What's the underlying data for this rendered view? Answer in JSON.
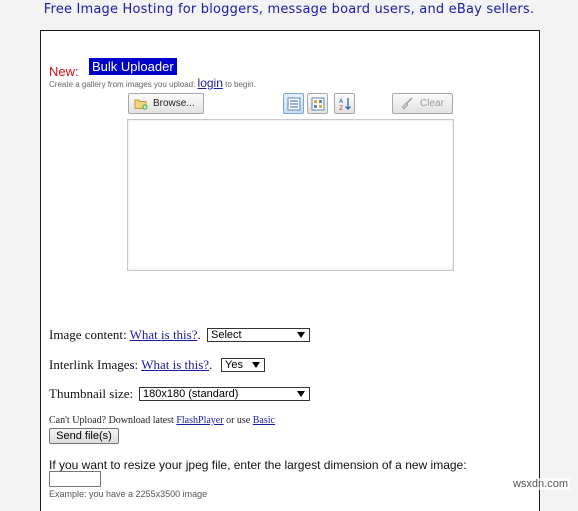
{
  "header": {
    "tagline": "Free Image Hosting for bloggers, message board users, and eBay sellers."
  },
  "uploader": {
    "new_label": "New:",
    "bulk_uploader_label": "Bulk Uploader",
    "gallery_prefix": "Create a gallery from images you upload:",
    "login_link": "login",
    "gallery_suffix": "to begin.",
    "browse_label": "Browse...",
    "clear_label": "Clear",
    "icons": [
      "folder-add-icon",
      "list-view-icon",
      "thumbnail-view-icon",
      "sort-az-icon",
      "broom-icon"
    ]
  },
  "options": {
    "image_content_label": "Image content:",
    "image_content_help": "What is this?",
    "image_content_help_suffix": ".",
    "image_content_value": "Select",
    "interlink_label": "Interlink Images:",
    "interlink_help": "What is this?",
    "interlink_help_suffix": ".",
    "interlink_value": "Yes",
    "thumbnail_label": "Thumbnail size:",
    "thumbnail_value": "180x180 (standard)"
  },
  "fallback": {
    "prefix": "Can't Upload? Download latest",
    "flash_link": "FlashPlayer",
    "middle": "or use",
    "basic_link": "Basic",
    "send_label": "Send file(s)"
  },
  "resize": {
    "prompt": "If you want to resize your jpeg file, enter the largest dimension of a new image:",
    "input_value": "",
    "example": "Example: you have a 2255x3500 image"
  },
  "watermark": "wsxdn.com"
}
